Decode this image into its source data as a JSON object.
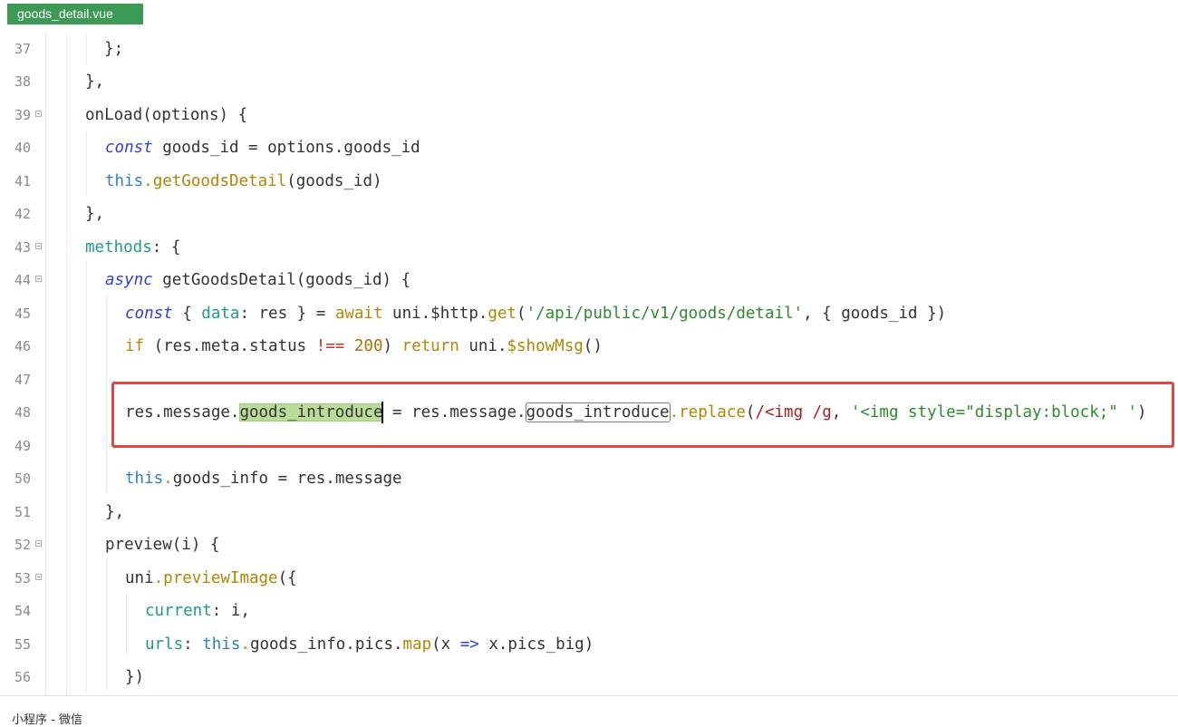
{
  "tab": {
    "filename": "goods_detail.vue"
  },
  "editor": {
    "lines": [
      {
        "num": "37",
        "fold": false
      },
      {
        "num": "38",
        "fold": false
      },
      {
        "num": "39",
        "fold": true
      },
      {
        "num": "40",
        "fold": false
      },
      {
        "num": "41",
        "fold": false
      },
      {
        "num": "42",
        "fold": false
      },
      {
        "num": "43",
        "fold": true
      },
      {
        "num": "44",
        "fold": true
      },
      {
        "num": "45",
        "fold": false
      },
      {
        "num": "46",
        "fold": false
      },
      {
        "num": "47",
        "fold": false
      },
      {
        "num": "48",
        "fold": false
      },
      {
        "num": "49",
        "fold": false
      },
      {
        "num": "50",
        "fold": false
      },
      {
        "num": "51",
        "fold": false
      },
      {
        "num": "52",
        "fold": true
      },
      {
        "num": "53",
        "fold": true
      },
      {
        "num": "54",
        "fold": false
      },
      {
        "num": "55",
        "fold": false
      },
      {
        "num": "56",
        "fold": false
      }
    ],
    "t": {
      "l37": "  };",
      "l38": "},",
      "l39": "onLoad(options) {",
      "const": "const",
      "async": "async",
      "if": "if",
      "this": "this",
      "dot": ".",
      "sp": " ",
      "i2": "  ",
      "i4": "    ",
      "i6": "      ",
      "l40a": " goods_id = options",
      "l40b": "goods_id",
      "l41a": "getGoodsDetail",
      "l41b": "(goods_id)",
      "l42": "},",
      "methods": "methods",
      "colon_brace": ": {",
      "l44b": " getGoodsDetail(goods_id) {",
      "l45a": " { ",
      "data": "data",
      "l45b": ": res } = ",
      "await": "await",
      "l45c": " uni.$http.",
      "get": "get",
      "l45d": "(",
      "l45str": "'/api/public/v1/goods/detail'",
      "l45e": ", { goods_id })",
      "l46a": " (res.meta.status ",
      "neq": "!==",
      "n200": "200",
      "l46b": ") ",
      "return": "return",
      "l46c": " uni.",
      "showMsg": "$showMsg",
      "parens": "()",
      "l48a": "res.message.",
      "goods_introduce": "goods_introduce",
      "l48b": " = res.message.",
      "replace": "replace",
      "l48c": "(",
      "regex": "/<img /g",
      "l48d": ", ",
      "l48str": "'<img style=\"display:block;\" '",
      "l48e": ")",
      "l50a": "goods_info = res.message",
      "l51": "},",
      "l52": "preview(i) {",
      "uni": "uni",
      "previewImage": "previewImage",
      "l53b": "({",
      "current": "current",
      "l54b": ": i,",
      "urls": "urls",
      "l55b": ": ",
      "l55c": "goods_info.pics.",
      "map": "map",
      "l55d": "(x ",
      "arrow": "=>",
      "l55e": " x.pics_big)",
      "l56": "})"
    }
  },
  "status": {
    "text": "小程序 - 微信"
  }
}
